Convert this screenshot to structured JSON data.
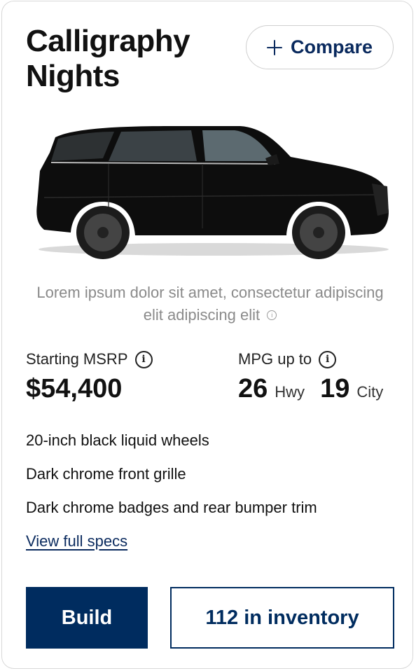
{
  "card": {
    "title": "Calligraphy Nights",
    "compare_label": "Compare",
    "image_alt": "black-suv",
    "description": "Lorem ipsum dolor sit amet, consectetur adipiscing elit adipiscing elit",
    "info_glyph": "i"
  },
  "pricing": {
    "msrp_label": "Starting MSRP",
    "msrp_value": "$54,400"
  },
  "mpg": {
    "label": "MPG up to",
    "hwy_value": "26",
    "hwy_unit": "Hwy",
    "city_value": "19",
    "city_unit": "City"
  },
  "features": [
    "20-inch black liquid wheels",
    "Dark chrome front grille",
    "Dark chrome badges and rear bumper trim"
  ],
  "links": {
    "view_specs": "View full specs"
  },
  "actions": {
    "build_label": "Build",
    "inventory_label": "112 in inventory"
  },
  "colors": {
    "brand_navy": "#002c5f",
    "text_muted": "#8a8a8a"
  },
  "icons": [
    "plus-icon",
    "info-icon"
  ]
}
